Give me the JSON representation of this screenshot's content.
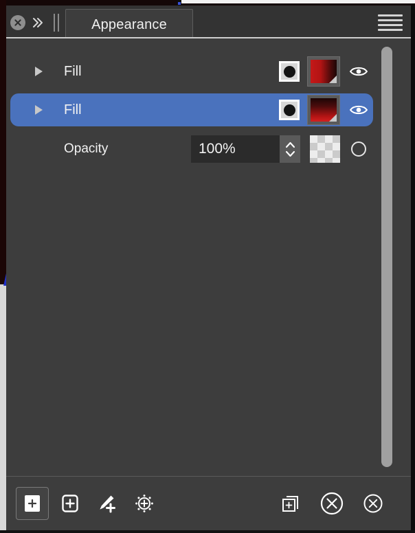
{
  "panel": {
    "tab_label": "Appearance",
    "close_icon": "close-circle-icon",
    "collapse_icon": "double-chevron-right-icon",
    "gripper_icon": "panel-gripper-icon",
    "menu_icon": "hamburger-menu-icon"
  },
  "rows": [
    {
      "label": "Fill",
      "disclosure_icon": "disclosure-triangle-right-icon",
      "target_icon": "circle-in-square-icon",
      "swatch_icon": "gradient-swatch-icon",
      "visibility_icon": "eye-icon",
      "selected": false
    },
    {
      "label": "Fill",
      "disclosure_icon": "disclosure-triangle-right-icon",
      "target_icon": "circle-in-square-icon",
      "swatch_icon": "gradient-swatch-icon",
      "visibility_icon": "eye-icon",
      "selected": true
    }
  ],
  "opacity": {
    "label": "Opacity",
    "value": "100%",
    "placeholder": "100%",
    "stepper_icon": "stepper-up-down-icon",
    "checker_icon": "transparency-checkerboard-icon",
    "mask_icon": "empty-circle-icon"
  },
  "scrollbar": {
    "name": "vertical-scrollbar"
  },
  "footer": {
    "left_buttons": [
      {
        "name": "add-new-fill-button",
        "icon": "add-fill-icon",
        "pressed": true
      },
      {
        "name": "add-new-stroke-button",
        "icon": "add-stroke-icon",
        "pressed": false
      },
      {
        "name": "add-new-brush-button",
        "icon": "add-brush-icon",
        "pressed": false
      },
      {
        "name": "add-new-effect-button",
        "icon": "add-effect-icon",
        "pressed": false
      }
    ],
    "right_buttons": [
      {
        "name": "duplicate-item-button",
        "icon": "duplicate-icon"
      },
      {
        "name": "clear-appearance-button",
        "icon": "clear-appearance-circle-x-icon"
      },
      {
        "name": "delete-item-button",
        "icon": "delete-circle-x-icon"
      }
    ]
  },
  "colors": {
    "panel_bg": "#3d3d3d",
    "header_bg": "#333333",
    "selection_blue": "#4a72bd",
    "text": "#f2f2f2",
    "swatch_red": "#c41818",
    "input_bg": "#2b2b2b",
    "scrollbar_thumb": "#a0a0a0"
  }
}
